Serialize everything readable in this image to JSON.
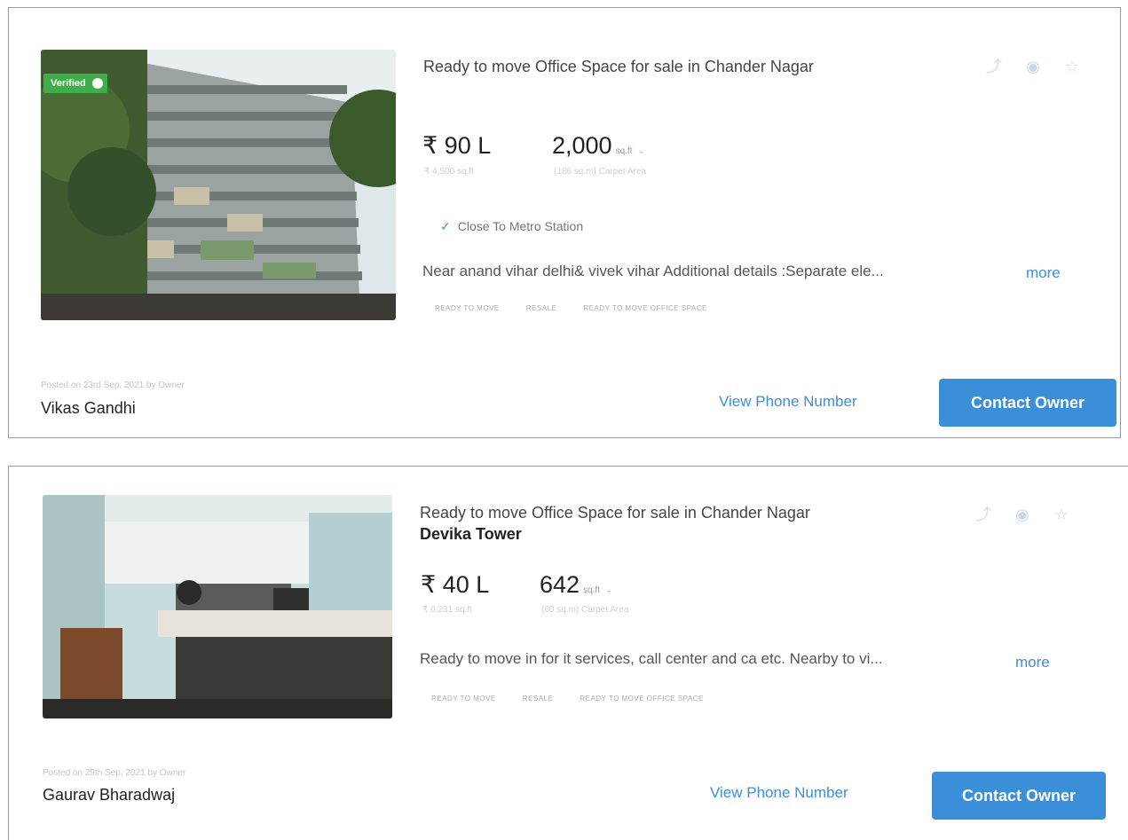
{
  "listings": [
    {
      "badge": "Verified",
      "title": "Ready to move Office Space for sale in Chander Nagar",
      "project": "",
      "price": "₹ 90 L",
      "price_per_sqft": "₹ 4,500 sq.ft",
      "area_value": "2,000",
      "area_unit": "sq.ft",
      "area_type": "(186 sq.m) Carpet Area",
      "highlight": "Close To Metro Station",
      "description": "Near anand vihar delhi& vivek vihar Additional details :Separate ele...",
      "more_label": "more",
      "tags": [
        "READY TO MOVE",
        "RESALE",
        "READY TO MOVE OFFICE SPACE"
      ],
      "posted": "Posted on 23rd Sep, 2021 by Owner",
      "owner_name": "Vikas Gandhi",
      "view_phone_label": "View Phone Number",
      "contact_label": "Contact Owner",
      "icons": [
        "share-icon",
        "eye-icon",
        "star-icon"
      ]
    },
    {
      "badge": "",
      "title": "Ready to move Office Space for sale in Chander Nagar",
      "project": "Devika Tower",
      "price": "₹ 40 L",
      "price_per_sqft": "₹ 6,231 sq.ft",
      "area_value": "642",
      "area_unit": "sq.ft",
      "area_type": "(60 sq.m) Carpet Area",
      "highlight": "",
      "description": "Ready to move in for it services, call center and ca etc. Nearby to vi...",
      "more_label": "more",
      "tags": [
        "READY TO MOVE",
        "RESALE",
        "READY TO MOVE OFFICE SPACE"
      ],
      "posted": "Posted on 29th Sep, 2021 by Owner",
      "owner_name": "Gaurav Bharadwaj",
      "view_phone_label": "View Phone Number",
      "contact_label": "Contact Owner",
      "icons": [
        "share-icon",
        "eye-icon",
        "star-icon"
      ]
    }
  ],
  "colors": {
    "accent": "#3b8fd9",
    "verified": "#3fae4a",
    "border": "#9a9a9a"
  }
}
